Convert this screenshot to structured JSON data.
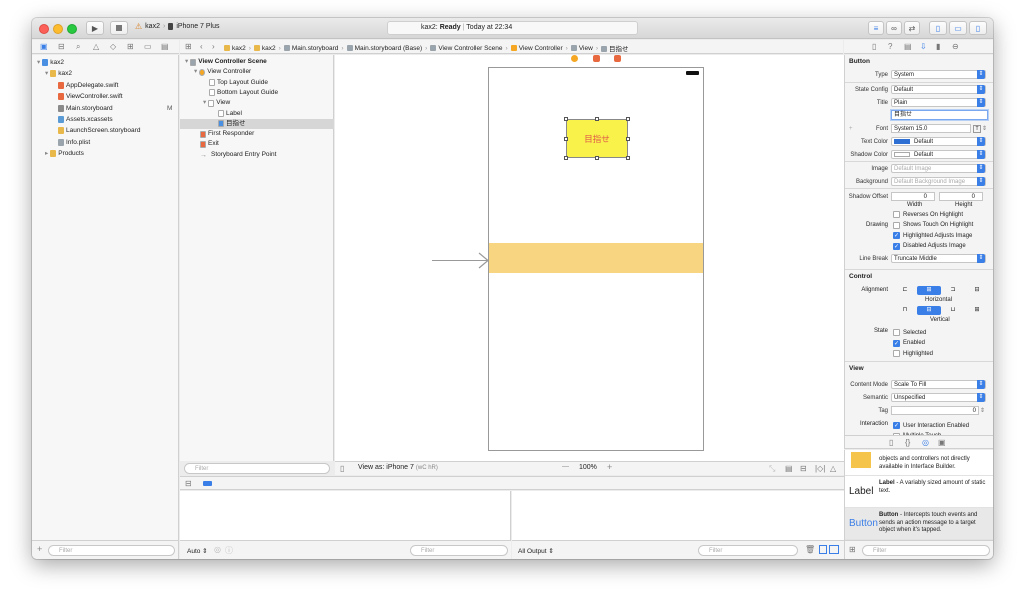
{
  "titlebar": {
    "scheme": "kax2",
    "device": "iPhone 7 Plus",
    "status_project": "kax2:",
    "status_state": "Ready",
    "status_time": "Today at 22:34"
  },
  "jump_bar": [
    "kax2",
    "kax2",
    "Main.storyboard",
    "Main.storyboard (Base)",
    "View Controller Scene",
    "View Controller",
    "View",
    "目指せ"
  ],
  "navigator": {
    "items": [
      {
        "label": "kax2",
        "indent": 0
      },
      {
        "label": "kax2",
        "indent": 1
      },
      {
        "label": "AppDelegate.swift",
        "indent": 2
      },
      {
        "label": "ViewController.swift",
        "indent": 2
      },
      {
        "label": "Main.storyboard",
        "indent": 2,
        "badge": "M"
      },
      {
        "label": "Assets.xcassets",
        "indent": 2
      },
      {
        "label": "LaunchScreen.storyboard",
        "indent": 2
      },
      {
        "label": "Info.plist",
        "indent": 2
      },
      {
        "label": "Products",
        "indent": 1
      }
    ],
    "filter_placeholder": "Filter"
  },
  "outline": {
    "items": [
      {
        "label": "View Controller Scene",
        "indent": 0,
        "bold": true
      },
      {
        "label": "View Controller",
        "indent": 1
      },
      {
        "label": "Top Layout Guide",
        "indent": 2
      },
      {
        "label": "Bottom Layout Guide",
        "indent": 2
      },
      {
        "label": "View",
        "indent": 2
      },
      {
        "label": "Label",
        "indent": 3
      },
      {
        "label": "目指せ",
        "indent": 3,
        "selected": true
      },
      {
        "label": "First Responder",
        "indent": 1
      },
      {
        "label": "Exit",
        "indent": 1
      },
      {
        "label": "Storyboard Entry Point",
        "indent": 1
      }
    ],
    "filter_placeholder": "Filter"
  },
  "canvas": {
    "button_title": "目指せ",
    "view_as": "View as: iPhone 7",
    "view_as_traits": "(wC hR)",
    "zoom": "100%"
  },
  "debug": {
    "auto_label": "Auto",
    "all_output": "All Output",
    "filter_placeholder": "Filter"
  },
  "inspector": {
    "section_button": "Button",
    "type_label": "Type",
    "type_value": "System",
    "state_config_label": "State Config",
    "state_config_value": "Default",
    "title_label": "Title",
    "title_value": "Plain",
    "title_text": "目指せ",
    "font_label": "Font",
    "font_value": "System 15.0",
    "text_color_label": "Text Color",
    "text_color_value": "Default",
    "shadow_color_label": "Shadow Color",
    "shadow_color_value": "Default",
    "image_label": "Image",
    "image_placeholder": "Default Image",
    "background_label": "Background",
    "background_placeholder": "Default Background Image",
    "shadow_offset_label": "Shadow Offset",
    "shadow_w": "0",
    "shadow_h": "0",
    "width_label": "Width",
    "height_label": "Height",
    "drawing_label": "Drawing",
    "drawing_opts": [
      {
        "label": "Reverses On Highlight",
        "checked": false
      },
      {
        "label": "Shows Touch On Highlight",
        "checked": false
      },
      {
        "label": "Highlighted Adjusts Image",
        "checked": true
      },
      {
        "label": "Disabled Adjusts Image",
        "checked": true
      }
    ],
    "line_break_label": "Line Break",
    "line_break_value": "Truncate Middle",
    "section_control": "Control",
    "alignment_label": "Alignment",
    "horizontal_label": "Horizontal",
    "vertical_label": "Vertical",
    "state_label": "State",
    "state_opts": [
      {
        "label": "Selected",
        "checked": false
      },
      {
        "label": "Enabled",
        "checked": true
      },
      {
        "label": "Highlighted",
        "checked": false
      }
    ],
    "section_view": "View",
    "content_mode_label": "Content Mode",
    "content_mode_value": "Scale To Fill",
    "semantic_label": "Semantic",
    "semantic_value": "Unspecified",
    "tag_label": "Tag",
    "tag_value": "0",
    "interaction_label": "Interaction",
    "interaction_opts": [
      {
        "label": "User Interaction Enabled",
        "checked": true
      },
      {
        "label": "Multiple Touch",
        "checked": false
      }
    ]
  },
  "library": {
    "items": [
      {
        "title": "",
        "desc": "objects and controllers not directly available in Interface Builder.",
        "preview": "bar"
      },
      {
        "title": "Label",
        "desc": "- A variably sized amount of static text.",
        "preview": "Label"
      },
      {
        "title": "Button",
        "desc": "- Intercepts touch events and sends an action message to a target object when it's tapped.",
        "preview": "Button"
      }
    ],
    "filter_placeholder": "Filter"
  },
  "colors": {
    "accent": "#3a7ee7",
    "button_fill": "#f8f24a",
    "button_text": "#e0584a",
    "band": "#f7d581"
  }
}
